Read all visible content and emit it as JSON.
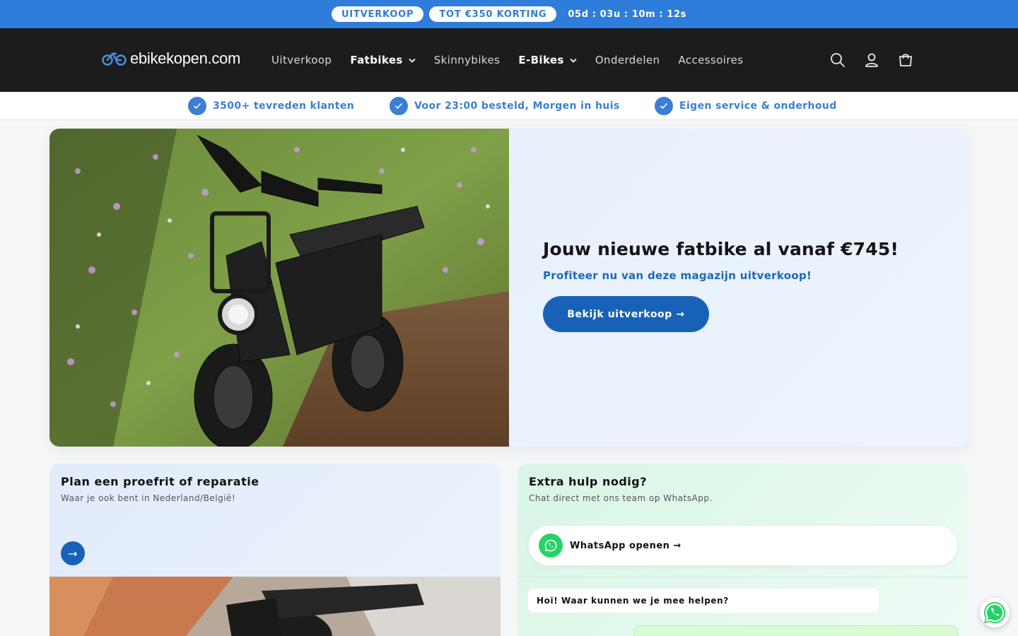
{
  "announcement": {
    "badge_sale": "UITVERKOOP",
    "badge_discount": "TOT €350 KORTING",
    "countdown": "05d : 03u : 10m : 12s"
  },
  "header": {
    "logo_text": "ebikekopen.com",
    "nav": [
      {
        "label": "Uitverkoop",
        "has_dropdown": false
      },
      {
        "label": "Fatbikes",
        "has_dropdown": true
      },
      {
        "label": "Skinnybikes",
        "has_dropdown": false
      },
      {
        "label": "E-Bikes",
        "has_dropdown": true
      },
      {
        "label": "Onderdelen",
        "has_dropdown": false
      },
      {
        "label": "Accessoires",
        "has_dropdown": false
      }
    ],
    "icons": [
      "search-icon",
      "account-icon",
      "cart-icon"
    ]
  },
  "usp": [
    {
      "label": "3500+ tevreden klanten"
    },
    {
      "label": "Voor 23:00 besteld, Morgen in huis"
    },
    {
      "label": "Eigen service & onderhoud"
    }
  ],
  "hero": {
    "title": "Jouw nieuwe fatbike al vanaf €745!",
    "subtitle": "Profiteer nu van deze magazijn uitverkoop!",
    "button_label": "Bekijk uitverkoop →"
  },
  "cards": {
    "left": {
      "title": "Plan een proefrit of reparatie",
      "subtitle": "Waar je ook bent in Nederland/België!",
      "arrow": "→"
    },
    "right": {
      "title": "Extra hulp nodig?",
      "subtitle": "Chat direct met ons team op WhatsApp.",
      "button_label": "WhatsApp openen →",
      "chat_message": "Hoi! Waar kunnen we je mee helpen?"
    }
  },
  "colors": {
    "announcement_bg": "#2f7ddb",
    "header_bg": "#1c1c1c",
    "primary": "#1762b6",
    "usp_text": "#3a7fd4",
    "whatsapp": "#25d366"
  }
}
